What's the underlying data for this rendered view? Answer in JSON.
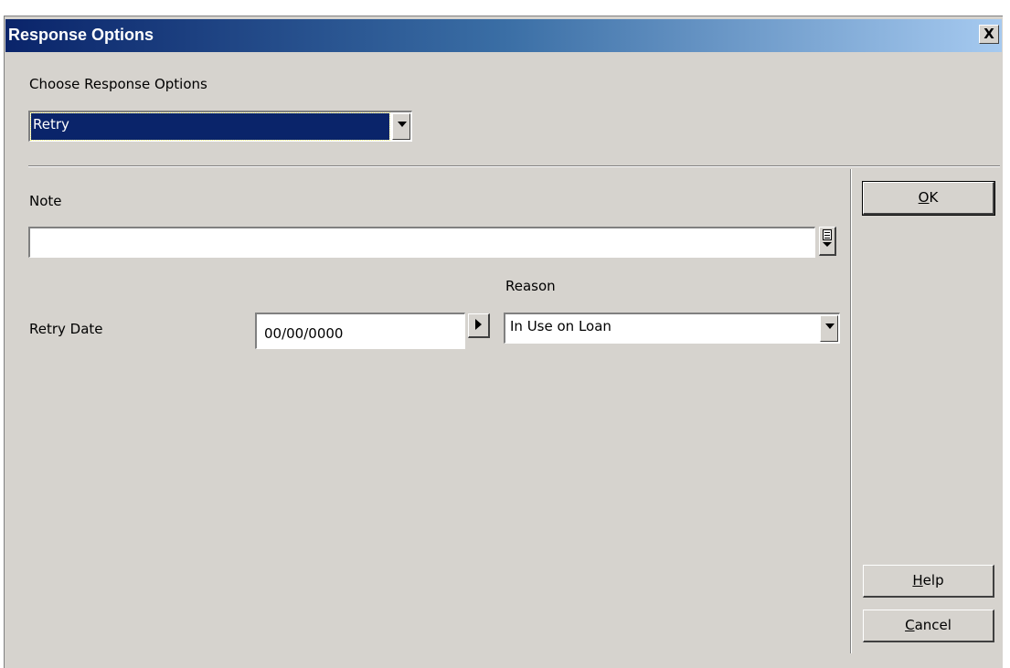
{
  "window": {
    "title": "Response Options",
    "close_label": "X"
  },
  "response": {
    "label": "Choose Response Options",
    "selected": "Retry"
  },
  "note": {
    "label": "Note",
    "value": ""
  },
  "retry": {
    "label": "Retry Date",
    "date_value": "00/00/0000"
  },
  "reason": {
    "label": "Reason",
    "selected": "In Use on Loan"
  },
  "buttons": {
    "ok_mnemonic": "O",
    "ok_rest": "K",
    "help_mnemonic": "H",
    "help_rest": "elp",
    "cancel_mnemonic": "C",
    "cancel_rest": "ancel"
  },
  "colors": {
    "title_start": "#0a246a",
    "title_end": "#a6caf0",
    "face": "#d6d3ce"
  },
  "icons": [
    "close-icon",
    "dropdown-arrow-icon",
    "note-expand-icon",
    "date-picker-arrow-icon"
  ]
}
